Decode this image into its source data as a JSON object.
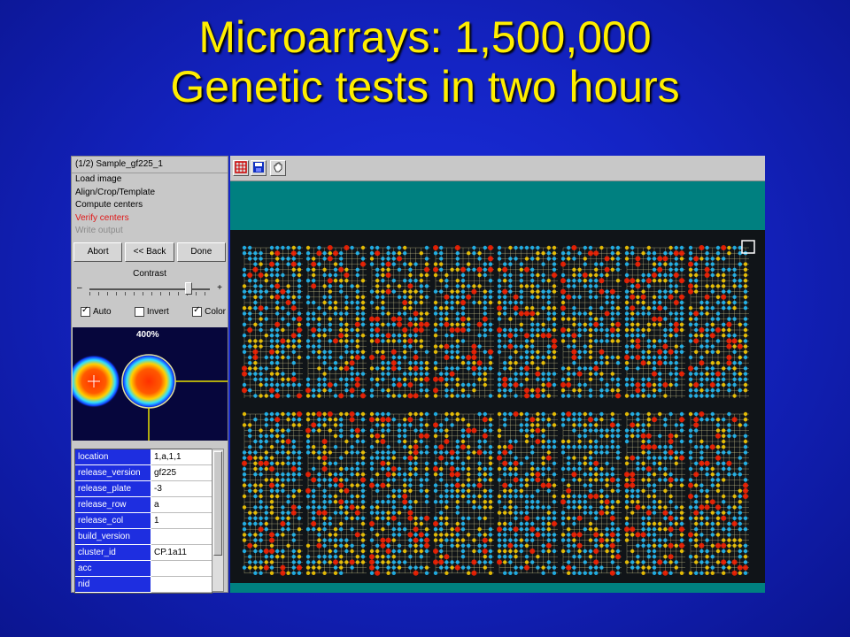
{
  "slide": {
    "title_line1": "Microarrays: 1,500,000",
    "title_line2": "Genetic tests in two hours"
  },
  "panel": {
    "header": "(1/2) Sample_gf225_1",
    "steps": [
      {
        "label": "Load image",
        "state": "done"
      },
      {
        "label": "Align/Crop/Template",
        "state": "done"
      },
      {
        "label": "Compute centers",
        "state": "done"
      },
      {
        "label": "Verify centers",
        "state": "active"
      },
      {
        "label": "Write output",
        "state": "disabled"
      }
    ],
    "buttons": {
      "abort": "Abort",
      "back": "<< Back",
      "done": "Done"
    },
    "contrast": {
      "label": "Contrast",
      "minus": "–",
      "plus": "+",
      "level": 0.82
    },
    "checkboxes": {
      "auto": {
        "label": "Auto",
        "checked": true
      },
      "invert": {
        "label": "Invert",
        "checked": false
      },
      "color": {
        "label": "Color",
        "checked": true
      }
    },
    "zoom_label": "400%",
    "properties": [
      {
        "key": "location",
        "value": "1,a,1,1"
      },
      {
        "key": "release_version",
        "value": "gf225"
      },
      {
        "key": "release_plate",
        "value": "-3"
      },
      {
        "key": "release_row",
        "value": "a"
      },
      {
        "key": "release_col",
        "value": "1"
      },
      {
        "key": "build_version",
        "value": ""
      },
      {
        "key": "cluster_id",
        "value": "CP.1a11"
      },
      {
        "key": "acc",
        "value": ""
      },
      {
        "key": "nid",
        "value": ""
      }
    ]
  },
  "viewer": {
    "toolbar_icons": [
      "grid-icon",
      "save-icon",
      "hand-icon"
    ],
    "colors": {
      "teal": "#008080",
      "grid": "#e8e0a0",
      "hot": "#ff2000",
      "warm": "#ffd000",
      "cool": "#20c0ff"
    }
  }
}
